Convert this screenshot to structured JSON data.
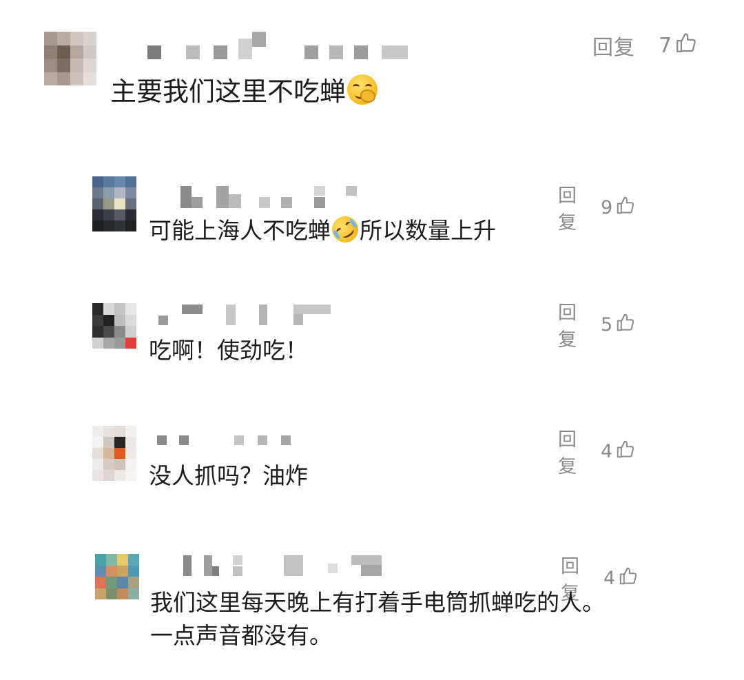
{
  "comments": [
    {
      "text_before": "主要我们这里不吃蝉",
      "text_after": "",
      "emoji": "hand-over-mouth-emoji",
      "reply_label": "回复",
      "likes": "7",
      "like_icon": "thumbs-up-icon"
    },
    {
      "text_before": "可能上海人不吃蝉",
      "text_after": "所以数量上升",
      "emoji": "rolling-on-floor-laughing-emoji",
      "reply_label": "回复",
      "likes": "9",
      "like_icon": "thumbs-up-icon"
    },
    {
      "text_before": "吃啊！使劲吃！",
      "reply_label": "回复",
      "likes": "5",
      "like_icon": "thumbs-up-icon"
    },
    {
      "text_before": "没人抓吗？油炸",
      "reply_label": "回复",
      "likes": "4",
      "like_icon": "thumbs-up-icon"
    },
    {
      "text_line1": "我们这里每天晚上有打着手电筒抓蝉吃的人。",
      "text_line2": "一点声音都没有。",
      "reply_label": "回复",
      "likes": "4",
      "like_icon": "thumbs-up-icon"
    }
  ],
  "colors": {
    "text": "#1c1c1c",
    "meta": "#8a8a8a",
    "background": "#ffffff"
  }
}
